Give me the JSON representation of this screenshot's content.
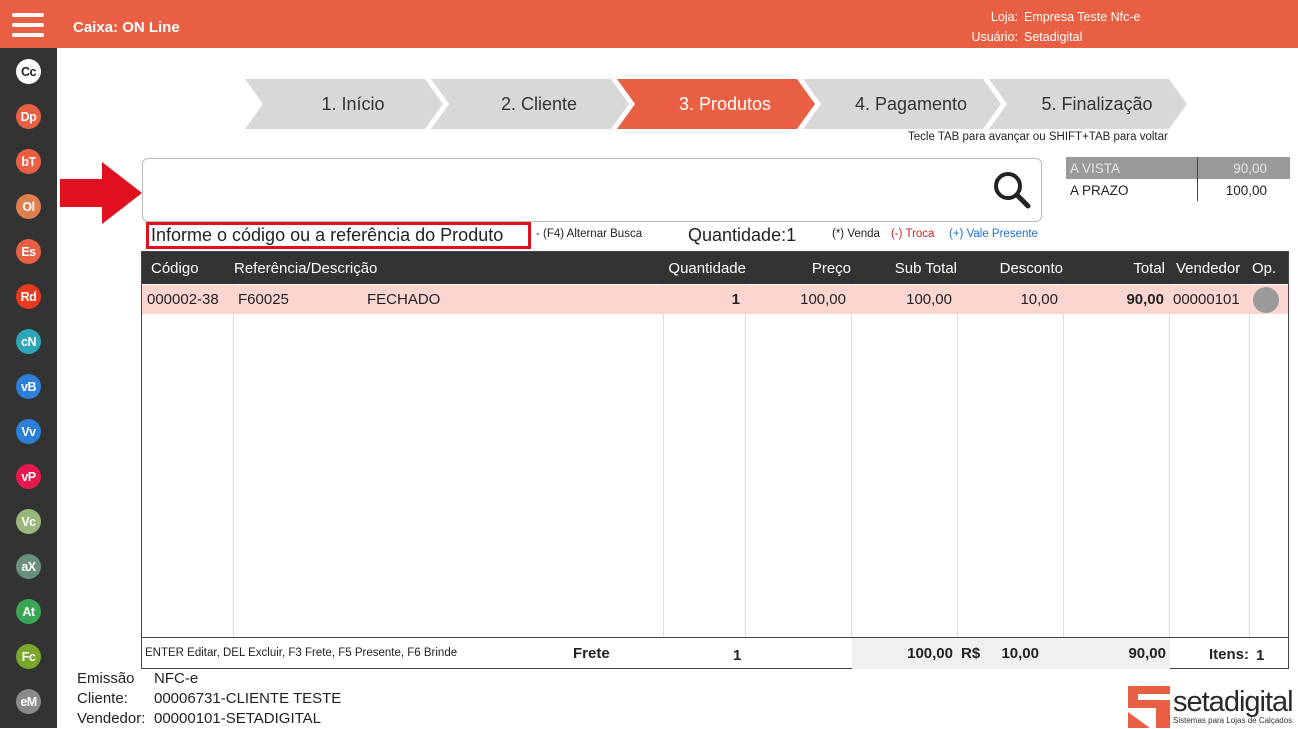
{
  "header": {
    "title": "Caixa: ON Line",
    "loja_label": "Loja:",
    "loja_value": "Empresa Teste Nfc-e",
    "usuario_label": "Usuário:",
    "usuario_value": "Setadigital",
    "color": "#e95f43"
  },
  "sidebar": [
    {
      "label": "Cc",
      "color": "#ffffff",
      "text_color": "#222222"
    },
    {
      "label": "Dp",
      "color": "#e95f43"
    },
    {
      "label": "bT",
      "color": "#e95f43"
    },
    {
      "label": "Ol",
      "color": "#e07f4e"
    },
    {
      "label": "Es",
      "color": "#e95f43"
    },
    {
      "label": "Rd",
      "color": "#e53a1f"
    },
    {
      "label": "cN",
      "color": "#2aa6b6"
    },
    {
      "label": "vB",
      "color": "#2b7fd8"
    },
    {
      "label": "Vv",
      "color": "#2a7fd6"
    },
    {
      "label": "vP",
      "color": "#e5194b"
    },
    {
      "label": "Vc",
      "color": "#9ab77b"
    },
    {
      "label": "aX",
      "color": "#6a8f7d"
    },
    {
      "label": "At",
      "color": "#3aa655"
    },
    {
      "label": "Fc",
      "color": "#7aa82a"
    },
    {
      "label": "eM",
      "color": "#8a8a8a"
    }
  ],
  "steps": [
    {
      "label": "1. Início",
      "active": false
    },
    {
      "label": "2. Cliente",
      "active": false
    },
    {
      "label": "3. Produtos",
      "active": true
    },
    {
      "label": "4. Pagamento",
      "active": false
    },
    {
      "label": "5. Finalização",
      "active": false
    }
  ],
  "tab_hint": "Tecle TAB para avançar ou SHIFT+TAB para voltar",
  "search": {
    "value": "",
    "placeholder": ""
  },
  "prices": [
    {
      "label": "A VISTA",
      "value": "90,00",
      "highlight": true
    },
    {
      "label": "A PRAZO",
      "value": "100,00",
      "highlight": false
    }
  ],
  "hint": {
    "info": "Informe o código ou a referência do Produto",
    "f4": "- (F4) Alternar Busca",
    "qty_label": "Quantidade:",
    "qty_value": "1",
    "venda": "(*) Venda",
    "troca": "(-) Troca",
    "vale": "(+) Vale Presente",
    "venda_color": "#222222",
    "troca_color": "#d62020",
    "vale_color": "#1e6fd0"
  },
  "grid": {
    "columns": [
      "Código",
      "Referência/Descrição",
      "Quantidade",
      "Preço",
      "Sub Total",
      "Desconto",
      "Total",
      "Vendedor",
      "Op."
    ],
    "rows": [
      {
        "codigo": "000002-38",
        "referencia": "F60025",
        "descricao": "FECHADO",
        "quantidade": "1",
        "preco": "100,00",
        "subtotal": "100,00",
        "desconto": "10,00",
        "total": "90,00",
        "vendedor": "00000101"
      }
    ],
    "footer": {
      "shortcuts": "ENTER Editar, DEL Excluir, F3 Frete, F5 Presente, F6 Brinde",
      "frete_label": "Frete",
      "quantidade": "1",
      "subtotal": "100,00",
      "currency": "R$",
      "desconto": "10,00",
      "total": "90,00",
      "itens_label": "Itens:",
      "itens_value": "1"
    }
  },
  "bottom": {
    "emissao_label": "Emissão",
    "emissao_value": "NFC-e",
    "cliente_label": "Cliente:",
    "cliente_value": "00006731-CLIENTE TESTE",
    "vendedor_label": "Vendedor:",
    "vendedor_value": "00000101-SETADIGITAL"
  },
  "logo": {
    "text": "setadigital",
    "sub": "Sistemas para Lojas de Calçados",
    "color": "#e95f43"
  }
}
